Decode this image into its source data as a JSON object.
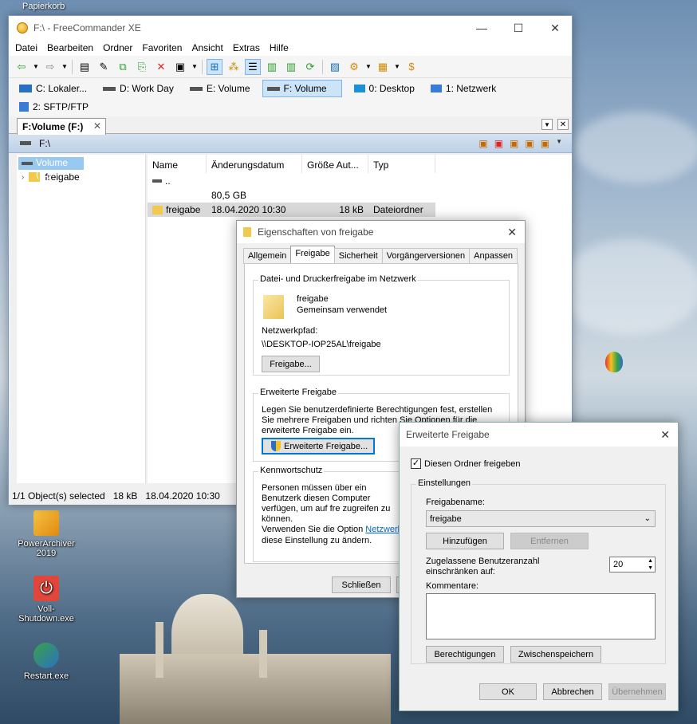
{
  "desktop": {
    "top_label": "Papierkorb",
    "icons": [
      {
        "label": "PowerArchiver 2019"
      },
      {
        "label": "Voll-Shutdown.exe"
      },
      {
        "label": "Restart.exe"
      }
    ]
  },
  "fc": {
    "title": "F:\\ - FreeCommander XE",
    "menu": [
      "Datei",
      "Bearbeiten",
      "Ordner",
      "Favoriten",
      "Ansicht",
      "Extras",
      "Hilfe"
    ],
    "drives": [
      {
        "label": "C: Lokaler...",
        "color": "#2b6fc1"
      },
      {
        "label": "D: Work Day",
        "color": "#555555"
      },
      {
        "label": "E: Volume",
        "color": "#555555"
      },
      {
        "label": "F: Volume",
        "color": "#555555"
      },
      {
        "label": "0: Desktop",
        "color": "#1e90d6"
      },
      {
        "label": "1: Netzwerk",
        "color": "#3a7bd5"
      },
      {
        "label": "2: SFTP/FTP",
        "color": "#3a7bd5"
      }
    ],
    "tab_label": "F:Volume (F:)",
    "path": "F:\\",
    "tree": {
      "root": "Volume (F:)",
      "child": "freigabe"
    },
    "columns": [
      "Name",
      "Änderungsdatum",
      "Größe Aut...",
      "Typ"
    ],
    "rows": [
      {
        "name": "..",
        "date": "",
        "size": "",
        "type": ""
      },
      {
        "name": "",
        "date": "80,5 GB",
        "size": "",
        "type": ""
      },
      {
        "name": "freigabe",
        "date": "18.04.2020 10:30",
        "size": "18 kB",
        "type": "Dateiordner"
      }
    ],
    "status": "1/1 Object(s) selected   18 kB   18.04.2020 10:30"
  },
  "props": {
    "title": "Eigenschaften von freigabe",
    "tabs": [
      "Allgemein",
      "Freigabe",
      "Sicherheit",
      "Vorgängerversionen",
      "Anpassen"
    ],
    "group1_label": "Datei- und Druckerfreigabe im Netzwerk",
    "folder_name": "freigabe",
    "folder_status": "Gemeinsam verwendet",
    "netpath_label": "Netzwerkpfad:",
    "netpath": "\\\\DESKTOP-IOP25AL\\freigabe",
    "share_btn": "Freigabe...",
    "group2_label": "Erweiterte Freigabe",
    "group2_text": "Legen Sie benutzerdefinierte Berechtigungen fest, erstellen Sie mehrere Freigaben und richten Sie Optionen für die erweiterte Freigabe ein.",
    "adv_btn": "Erweiterte Freigabe...",
    "group3_label": "Kennwortschutz",
    "group3_text": "Personen müssen über ein Benutzerk diesen Computer verfügen, um auf fre zugreifen zu können.",
    "group3_text2": "Verwenden Sie die Option ",
    "group3_link": "Netzwerk-",
    "group3_text3": "diese Einstellung zu ändern.",
    "close_btn": "Schließen"
  },
  "adv": {
    "title": "Erweiterte Freigabe",
    "checkbox_label": "Diesen Ordner freigeben",
    "checked": true,
    "settings_label": "Einstellungen",
    "sharename_label": "Freigabename:",
    "sharename_value": "freigabe",
    "add_btn": "Hinzufügen",
    "remove_btn": "Entfernen",
    "limit_label": "Zugelassene Benutzeranzahl einschränken auf:",
    "limit_value": "20",
    "comment_label": "Kommentare:",
    "perm_btn": "Berechtigungen",
    "cache_btn": "Zwischenspeichern",
    "ok_btn": "OK",
    "cancel_btn": "Abbrechen",
    "apply_btn": "Übernehmen"
  }
}
